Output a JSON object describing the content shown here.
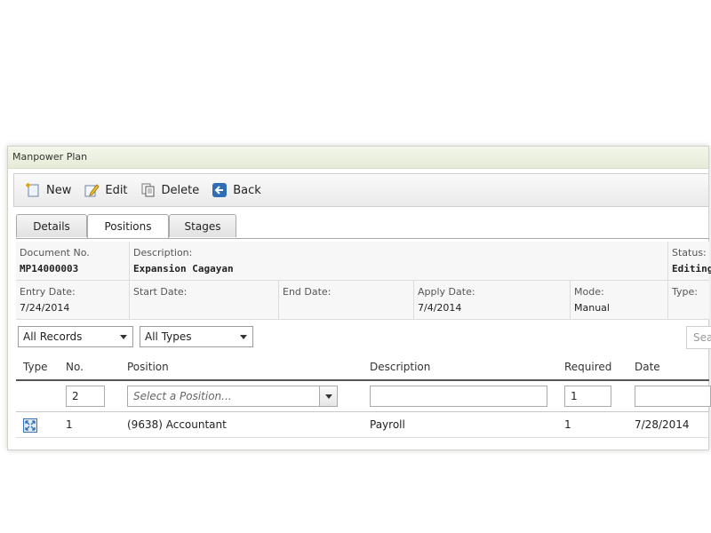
{
  "panel": {
    "title": "Manpower Plan"
  },
  "toolbar": {
    "new_label": "New",
    "edit_label": "Edit",
    "delete_label": "Delete",
    "back_label": "Back"
  },
  "tabs": [
    {
      "label": "Details",
      "active": false
    },
    {
      "label": "Positions",
      "active": true
    },
    {
      "label": "Stages",
      "active": false
    }
  ],
  "info": {
    "document_no_label": "Document No.",
    "document_no": "MP14000003",
    "description_label": "Description:",
    "description": "Expansion Cagayan",
    "status_label": "Status:",
    "status": "Editing",
    "entry_date_label": "Entry Date:",
    "entry_date": "7/24/2014",
    "start_date_label": "Start Date:",
    "start_date": "",
    "end_date_label": "End Date:",
    "end_date": "",
    "apply_date_label": "Apply Date:",
    "apply_date": "7/4/2014",
    "mode_label": "Mode:",
    "mode": "Manual",
    "type_label": "Type:",
    "type": ""
  },
  "filters": {
    "records": "All Records",
    "types": "All Types",
    "search_placeholder": "Search"
  },
  "grid": {
    "columns": [
      "Type",
      "No.",
      "Position",
      "Description",
      "Required",
      "Date"
    ],
    "filter_row": {
      "no": "2",
      "position_placeholder": "Select a Position...",
      "description": "",
      "required": "1",
      "date": ""
    },
    "rows": [
      {
        "type_icon": "expand-icon",
        "no": "1",
        "position": "(9638) Accountant",
        "description": "Payroll",
        "required": "1",
        "date": "7/28/2014"
      }
    ]
  },
  "colors": {
    "accent_blue": "#2f6db5",
    "header_green": "#e9eedc"
  }
}
